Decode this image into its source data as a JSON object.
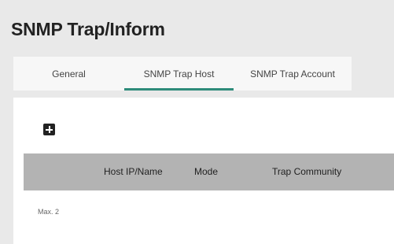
{
  "page": {
    "title": "SNMP Trap/Inform"
  },
  "tabs": [
    {
      "label": "General",
      "active": false
    },
    {
      "label": "SNMP Trap Host",
      "active": true
    },
    {
      "label": "SNMP Trap Account",
      "active": false
    }
  ],
  "toolbar": {
    "add_icon": "plus-box-icon"
  },
  "table": {
    "columns": [
      "",
      "Host IP/Name",
      "Mode",
      "Trap Community"
    ],
    "rows": []
  },
  "footer": {
    "max_note": "Max. 2"
  },
  "colors": {
    "accent": "#2e8b7a",
    "header_bg": "#b3b3b3",
    "page_bg": "#e9e9e9"
  }
}
